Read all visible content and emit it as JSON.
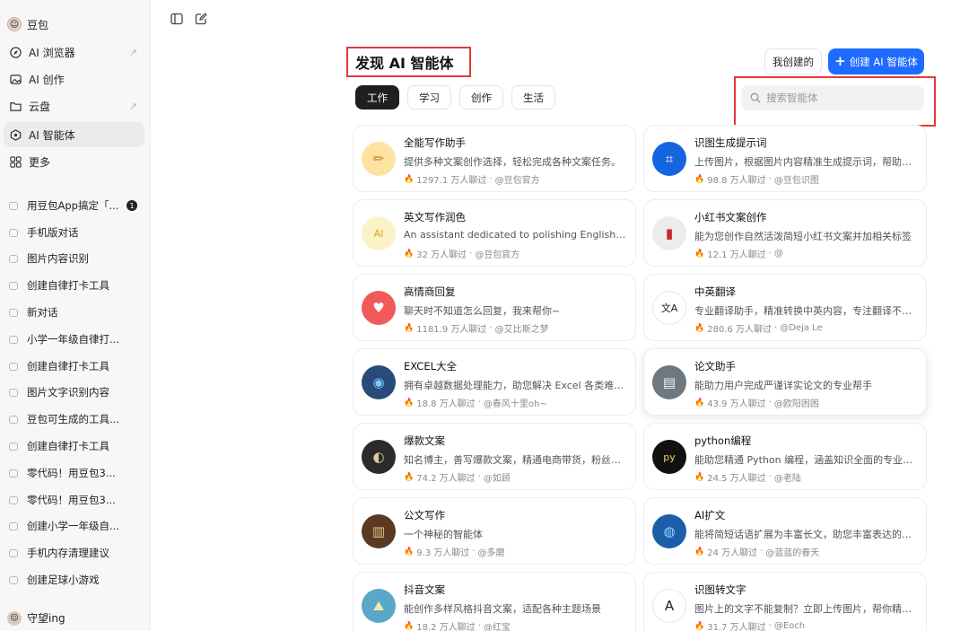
{
  "sidebar": {
    "brand": "豆包",
    "nav": [
      {
        "label": "AI 浏览器",
        "icon": "compass-icon",
        "external": true
      },
      {
        "label": "AI 创作",
        "icon": "image-icon",
        "external": false
      },
      {
        "label": "云盘",
        "icon": "folder-icon",
        "external": true
      },
      {
        "label": "AI 智能体",
        "icon": "agent-icon",
        "external": false,
        "active": true
      },
      {
        "label": "更多",
        "icon": "grid-icon",
        "external": false
      }
    ],
    "chats": [
      {
        "label": "用豆包App搞定「...",
        "badge": "1"
      },
      {
        "label": "手机版对话"
      },
      {
        "label": "图片内容识别"
      },
      {
        "label": "创建自律打卡工具"
      },
      {
        "label": "新对话"
      },
      {
        "label": "小学一年级自律打..."
      },
      {
        "label": "创建自律打卡工具"
      },
      {
        "label": "图片文字识别内容"
      },
      {
        "label": "豆包可生成的工具..."
      },
      {
        "label": "创建自律打卡工具"
      },
      {
        "label": "零代码！用豆包3..."
      },
      {
        "label": "零代码！用豆包3..."
      },
      {
        "label": "创建小学一年级自..."
      },
      {
        "label": "手机内存清理建议"
      },
      {
        "label": "创建足球小游戏"
      }
    ],
    "user": "守望ing"
  },
  "header": {
    "title": "发现 AI 智能体",
    "mine_label": "我创建的",
    "create_label": "创建 AI 智能体"
  },
  "tabs": [
    {
      "label": "工作",
      "active": true
    },
    {
      "label": "学习"
    },
    {
      "label": "创作"
    },
    {
      "label": "生活"
    }
  ],
  "search": {
    "placeholder": "搜索智能体"
  },
  "cards": [
    {
      "name": "全能写作助手",
      "desc": "提供多种文案创作选择，轻松完成各种文案任务。",
      "chats": "1297.1 万人聊过",
      "author": "@豆包官方",
      "icon": "pencil-icon",
      "bg": "#fde3a1"
    },
    {
      "name": "识图生成提示词",
      "desc": "上传图片，根据图片内容精准生成提示词，帮助你...",
      "chats": "98.8 万人聊过",
      "author": "@豆包识图",
      "icon": "prompt-icon",
      "bg": "#1565e0"
    },
    {
      "name": "英文写作润色",
      "desc": "An assistant dedicated to polishing English writin...",
      "chats": "32 万人聊过",
      "author": "@豆包官方",
      "icon": "ai-text-icon",
      "bg": "#fdf1c8"
    },
    {
      "name": "小红书文案创作",
      "desc": "能为您创作自然活泼简短小红书文案并加相关标签",
      "chats": "12.1 万人聊过",
      "author": "@",
      "icon": "book-icon",
      "bg": "#ececec"
    },
    {
      "name": "高情商回复",
      "desc": "聊天时不知道怎么回复，我来帮你~",
      "chats": "1181.9 万人聊过",
      "author": "@艾比斯之梦",
      "icon": "heart-chat-icon",
      "bg": "#f25a5a"
    },
    {
      "name": "中英翻译",
      "desc": "专业翻译助手，精准转换中英内容，专注翻译不涉...",
      "chats": "280.6 万人聊过",
      "author": "@Deja Le",
      "icon": "translate-icon",
      "bg": "#ffffff"
    },
    {
      "name": "EXCEL大全",
      "desc": "拥有卓越数据处理能力，助您解决 Excel 各类难题...",
      "chats": "18.8 万人聊过",
      "author": "@春风十里oh~",
      "icon": "robot-icon",
      "bg": "#2a4a7a"
    },
    {
      "name": "论文助手",
      "desc": "能助力用户完成严谨详实论文的专业帮手",
      "chats": "43.9 万人聊过",
      "author": "@欧阳困困",
      "icon": "paper-icon",
      "bg": "#6e7880"
    },
    {
      "name": "爆款文案",
      "desc": "知名博主，善写爆款文案，精通电商带货，粉丝众...",
      "chats": "74.2 万人聊过",
      "author": "@如顾",
      "icon": "portrait-icon",
      "bg": "#2b2b2b"
    },
    {
      "name": "python编程",
      "desc": "能助您精通 Python 编程，涵盖知识全面的专业助手",
      "chats": "24.5 万人聊过",
      "author": "@老陆",
      "icon": "python-icon",
      "bg": "#111111"
    },
    {
      "name": "公文写作",
      "desc": "一个神秘的智能体",
      "chats": "9.3 万人聊过",
      "author": "@多磨",
      "icon": "books-icon",
      "bg": "#5a3a22"
    },
    {
      "name": "AI扩文",
      "desc": "能将简短话语扩展为丰富长文，助您丰富表达的伙...",
      "chats": "24 万人聊过",
      "author": "@蓝蓝的春天",
      "icon": "brain-icon",
      "bg": "#1a5fa8"
    },
    {
      "name": "抖音文案",
      "desc": "能创作多样风格抖音文案，适配各种主题场景",
      "chats": "18.2 万人聊过",
      "author": "@红宝",
      "icon": "landscape-icon",
      "bg": "#5aa7c8"
    },
    {
      "name": "识图转文字",
      "desc": "图片上的文字不能复制？立即上传图片，帮你精准...",
      "chats": "31.7 万人聊过",
      "author": "@Eoch",
      "icon": "scan-text-icon",
      "bg": "#ffffff"
    }
  ]
}
